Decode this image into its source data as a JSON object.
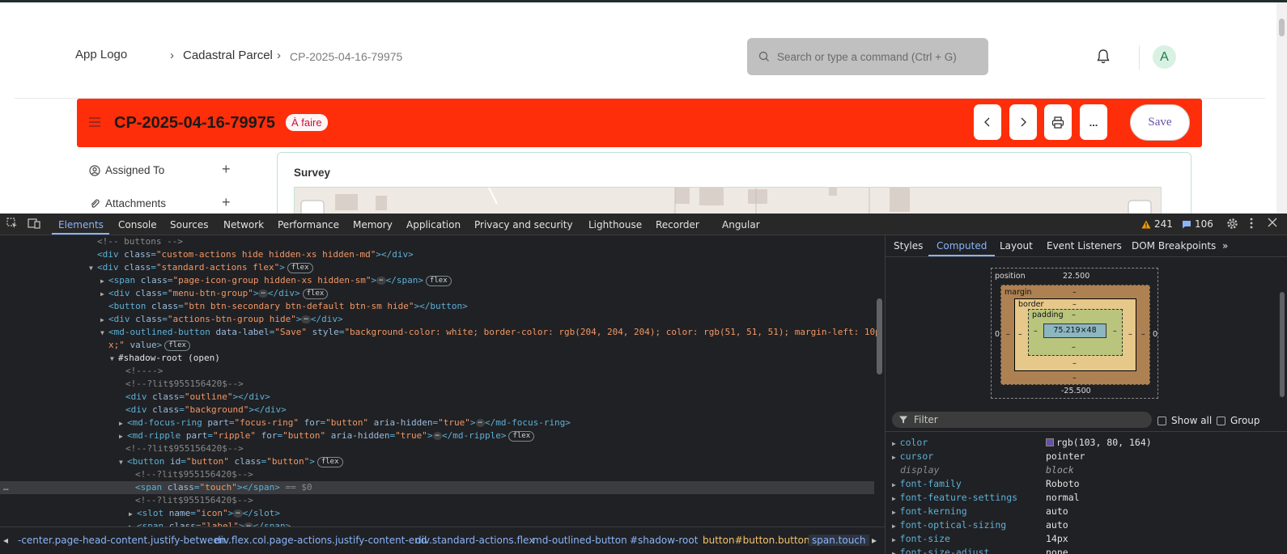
{
  "app": {
    "logo_alt": "App Logo",
    "breadcrumb": [
      "Cadastral Parcel",
      "CP-2025-04-16-79975"
    ],
    "search_placeholder": "Search or type a command (Ctrl + G)",
    "avatar_letter": "A",
    "doc_title": "CP-2025-04-16-79975",
    "status_badge": "À faire",
    "save_label": "Save",
    "more_label": "...",
    "sidebar": [
      {
        "label": "Assigned To",
        "icon": "user-add-icon"
      },
      {
        "label": "Attachments",
        "icon": "paperclip-icon"
      }
    ],
    "survey_title": "Survey",
    "colors": {
      "header_red": "#ff2e0a",
      "badge_text": "#c3123a",
      "save_text": "#6750a4"
    }
  },
  "devtools": {
    "tabs": [
      "Elements",
      "Console",
      "Sources",
      "Network",
      "Performance",
      "Memory",
      "Application",
      "Privacy and security",
      "Lighthouse",
      "Recorder",
      "Angular"
    ],
    "warnings": "241",
    "messages": "106",
    "dom_lines": [
      {
        "html": "<span class='cmt'>&lt;!-- buttons --&gt;</span>"
      },
      {
        "html": "<span class='tag'>&lt;div </span><span class='attr'>class</span><span class='tag'>=</span><span class='val'>\"custom-actions hide hidden-xs hidden-md\"</span><span class='tag'>&gt;&lt;/div&gt;</span>"
      },
      {
        "html": "<span class='tri'>▼</span><span class='tag'>&lt;div </span><span class='attr'>class</span><span class='tag'>=</span><span class='val'>\"standard-actions flex\"</span><span class='tag'>&gt;</span><span class='pill'>flex</span>"
      },
      {
        "html": "<span class='tri'>▶</span><span class='tag'>&lt;span </span><span class='attr'>class</span><span class='tag'>=</span><span class='val'>\"page-icon-group hidden-xs hidden-sm\"</span><span class='tag'>&gt;</span><span class='ell'>⋯</span><span class='tag'>&lt;/span&gt;</span><span class='pill'>flex</span>"
      },
      {
        "html": "<span class='tri'>▶</span><span class='tag'>&lt;div </span><span class='attr'>class</span><span class='tag'>=</span><span class='val'>\"menu-btn-group\"</span><span class='tag'>&gt;</span><span class='ell'>⋯</span><span class='tag'>&lt;/div&gt;</span><span class='pill'>flex</span>"
      },
      {
        "html": "<span class='tag'>&lt;button </span><span class='attr'>class</span><span class='tag'>=</span><span class='val'>\"btn btn-secondary btn-default btn-sm hide\"</span><span class='tag'>&gt;&lt;/button&gt;</span>"
      },
      {
        "html": "<span class='tri'>▶</span><span class='tag'>&lt;div </span><span class='attr'>class</span><span class='tag'>=</span><span class='val'>\"actions-btn-group hide\"</span><span class='tag'>&gt;</span><span class='ell'>⋯</span><span class='tag'>&lt;/div&gt;</span>"
      },
      {
        "html": "<span class='tri'>▼</span><span class='tag'>&lt;md-outlined-button </span><span class='attr'>data-label</span><span class='tag'>=</span><span class='val'>\"Save\"</span><span class='attr'> style</span><span class='tag'>=</span><span class='val'>\"background-color: white; border-color: rgb(204, 204, 204); color: rgb(51, 51, 51); margin-left: 10p</span>"
      },
      {
        "html": "<span class='val'>x;\"</span><span class='attr'> value</span><span class='tag'>&gt;</span><span class='pill'>flex</span>"
      },
      {
        "html": "<span class='tri'>▼</span><span class='txt'>#shadow-root (open)</span>"
      },
      {
        "html": "<span class='cmt'>&lt;!----&gt;</span>"
      },
      {
        "html": "<span class='cmt'>&lt;!--?lit$955156420$--&gt;</span>"
      },
      {
        "html": "<span class='tag'>&lt;div </span><span class='attr'>class</span><span class='tag'>=</span><span class='val'>\"outline\"</span><span class='tag'>&gt;&lt;/div&gt;</span>"
      },
      {
        "html": "<span class='tag'>&lt;div </span><span class='attr'>class</span><span class='tag'>=</span><span class='val'>\"background\"</span><span class='tag'>&gt;&lt;/div&gt;</span>"
      },
      {
        "html": "<span class='tri'>▶</span><span class='tag'>&lt;md-focus-ring </span><span class='attr'>part</span><span class='tag'>=</span><span class='val'>\"focus-ring\"</span><span class='attr'> for</span><span class='tag'>=</span><span class='val'>\"button\"</span><span class='attr'> aria-hidden</span><span class='tag'>=</span><span class='val'>\"true\"</span><span class='tag'>&gt;</span><span class='ell'>⋯</span><span class='tag'>&lt;/md-focus-ring&gt;</span>"
      },
      {
        "html": "<span class='tri'>▶</span><span class='tag'>&lt;md-ripple </span><span class='attr'>part</span><span class='tag'>=</span><span class='val'>\"ripple\"</span><span class='attr'> for</span><span class='tag'>=</span><span class='val'>\"button\"</span><span class='attr'> aria-hidden</span><span class='tag'>=</span><span class='val'>\"true\"</span><span class='tag'>&gt;</span><span class='ell'>⋯</span><span class='tag'>&lt;/md-ripple&gt;</span><span class='pill'>flex</span>"
      },
      {
        "html": "<span class='cmt'>&lt;!--?lit$955156420$--&gt;</span>"
      },
      {
        "html": "<span class='tri'>▼</span><span class='tag'>&lt;button </span><span class='attr'>id</span><span class='tag'>=</span><span class='val'>\"button\"</span><span class='attr'> class</span><span class='tag'>=</span><span class='val'>\"button\"</span><span class='tag'>&gt;</span><span class='pill'>flex</span>"
      },
      {
        "html": "<span class='cmt'>&lt;!--?lit$955156420$--&gt;</span>"
      },
      {
        "html": "<span class='tag'>&lt;span </span><span class='attr'>class</span><span class='tag'>=</span><span class='val'>\"touch\"</span><span class='tag'>&gt;&lt;/span&gt;</span><span class='cmt'> == $0</span>"
      },
      {
        "html": "<span class='cmt'>&lt;!--?lit$955156420$--&gt;</span>"
      },
      {
        "html": "<span class='tri'>▶</span><span class='tag'>&lt;slot </span><span class='attr'>name</span><span class='tag'>=</span><span class='val'>\"icon\"</span><span class='tag'>&gt;</span><span class='ell'>⋯</span><span class='tag'>&lt;/slot&gt;</span>"
      },
      {
        "html": "<span class='tri'>▶</span><span class='tag'>&lt;span </span><span class='attr'>class</span><span class='tag'>=</span><span class='val'>\"label\"</span><span class='tag'>&gt;</span><span class='ell'>⋯</span><span class='tag'>&lt;/span&gt;</span>"
      }
    ],
    "breadcrumbs": [
      "-center.page-head-content.justify-between",
      "div.flex.col.page-actions.justify-content-end",
      "div.standard-actions.flex",
      "md-outlined-button",
      "#shadow-root",
      "button#button.button",
      "span.touch"
    ],
    "side_tabs": [
      "Styles",
      "Computed",
      "Layout",
      "Event Listeners",
      "DOM Breakpoints"
    ],
    "box_model": {
      "position_label": "position",
      "position_top": "22.500",
      "position_bottom": "-25.500",
      "position_left": "0",
      "position_right": "0",
      "margin_label": "margin",
      "border_label": "border",
      "padding_label": "padding",
      "dash": "–",
      "content": "75.219×48"
    },
    "filter_placeholder": "Filter",
    "show_all": "Show all",
    "group": "Group",
    "computed": [
      {
        "name": "color",
        "value": "rgb(103, 80, 164)",
        "swatch": "#6750a4"
      },
      {
        "name": "cursor",
        "value": "pointer"
      },
      {
        "name": "display",
        "value": "block",
        "inherited": true
      },
      {
        "name": "font-family",
        "value": "Roboto"
      },
      {
        "name": "font-feature-settings",
        "value": "normal"
      },
      {
        "name": "font-kerning",
        "value": "auto"
      },
      {
        "name": "font-optical-sizing",
        "value": "auto"
      },
      {
        "name": "font-size",
        "value": "14px"
      },
      {
        "name": "font-size-adjust",
        "value": "none"
      }
    ]
  }
}
